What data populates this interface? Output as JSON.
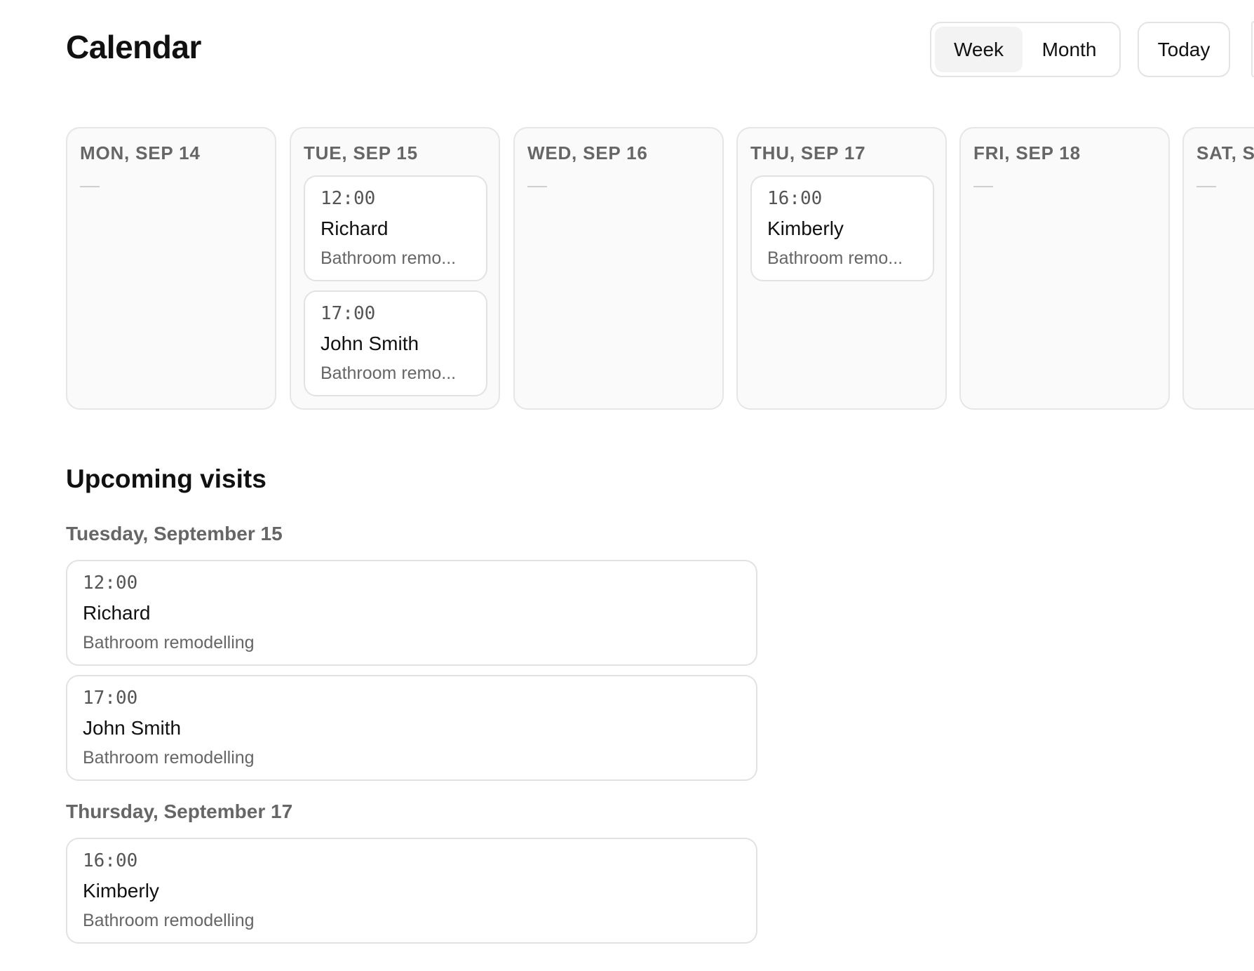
{
  "header": {
    "title": "Calendar",
    "view_toggle": {
      "week": "Week",
      "month": "Month",
      "selected": "Week"
    },
    "today_label": "Today"
  },
  "week": {
    "days": [
      {
        "label": "MON, SEP 14",
        "empty_marker": "—",
        "events": []
      },
      {
        "label": "TUE, SEP 15",
        "empty_marker": "",
        "events": [
          {
            "time": "12:00",
            "name": "Richard",
            "desc": "Bathroom remo..."
          },
          {
            "time": "17:00",
            "name": "John Smith",
            "desc": "Bathroom remo..."
          }
        ]
      },
      {
        "label": "WED, SEP 16",
        "empty_marker": "—",
        "events": []
      },
      {
        "label": "THU, SEP 17",
        "empty_marker": "",
        "events": [
          {
            "time": "16:00",
            "name": "Kimberly",
            "desc": "Bathroom remo..."
          }
        ]
      },
      {
        "label": "FRI, SEP 18",
        "empty_marker": "—",
        "events": []
      },
      {
        "label": "SAT, SE",
        "empty_marker": "—",
        "events": []
      }
    ]
  },
  "upcoming": {
    "title": "Upcoming visits",
    "groups": [
      {
        "date": "Tuesday, September 15",
        "visits": [
          {
            "time": "12:00",
            "name": "Richard",
            "desc": "Bathroom remodelling"
          },
          {
            "time": "17:00",
            "name": "John Smith",
            "desc": "Bathroom remodelling"
          }
        ]
      },
      {
        "date": "Thursday, September 17",
        "visits": [
          {
            "time": "16:00",
            "name": "Kimberly",
            "desc": "Bathroom remodelling"
          }
        ]
      }
    ]
  }
}
